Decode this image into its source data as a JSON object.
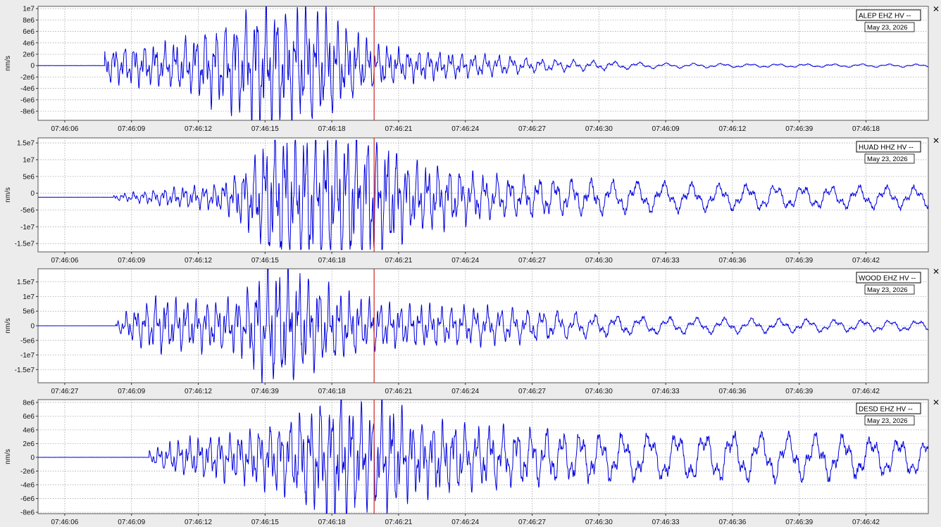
{
  "colors": {
    "trace": "#0000dd",
    "marker": "#cc2222",
    "grid": "#9a9a9a",
    "plot_bg": "#ffffff",
    "window_bg": "#ececec"
  },
  "icons": {
    "close": "close-icon"
  },
  "close_glyph": "✕",
  "chart_data": [
    {
      "type": "line",
      "station": "ALEP EHZ HV --",
      "date": "May 23, 2026",
      "ylabel": "nm/s",
      "yticks": [
        "1e7",
        "8e6",
        "6e6",
        "4e6",
        "2e6",
        "0",
        "-2e6",
        "-4e6",
        "-6e6",
        "-8e6"
      ],
      "xticks": [
        "07:46:06",
        "07:46:09",
        "07:46:12",
        "07:46:15",
        "07:46:18",
        "07:46:21",
        "07:46:24",
        "07:46:27",
        "07:46:30",
        "07:46:09",
        "07:46:12",
        "07:46:39",
        "07:46:18"
      ],
      "ylim": [
        -9600000,
        10400000
      ],
      "xlim": [
        4.8,
        44.8
      ],
      "marker_time": 19.9,
      "onset": 7.8,
      "envelope": [
        [
          7.8,
          2500000
        ],
        [
          9,
          3000000
        ],
        [
          11,
          3500000
        ],
        [
          12.5,
          5500000
        ],
        [
          14,
          8000000
        ],
        [
          15,
          9000000
        ],
        [
          17.5,
          8500000
        ],
        [
          19,
          5000000
        ],
        [
          20,
          3500000
        ],
        [
          21,
          2500000
        ],
        [
          23,
          2000000
        ],
        [
          25,
          1800000
        ],
        [
          27,
          1200000
        ],
        [
          30,
          900000
        ],
        [
          33,
          500000
        ],
        [
          36,
          400000
        ],
        [
          40,
          350000
        ],
        [
          44.8,
          300000
        ]
      ],
      "seed": 11,
      "clip": false
    },
    {
      "type": "line",
      "station": "HUAD HHZ HV --",
      "date": "May 23, 2026",
      "ylabel": "nm/s",
      "yticks": [
        "1.5e7",
        "1e7",
        "5e6",
        "0",
        "-5e6",
        "-1e7",
        "-1.5e7"
      ],
      "xticks": [
        "07:46:06",
        "07:46:09",
        "07:46:12",
        "07:46:15",
        "07:46:18",
        "07:46:21",
        "07:46:24",
        "07:46:27",
        "07:46:30",
        "07:46:33",
        "07:46:36",
        "07:46:39",
        "07:46:42"
      ],
      "ylim": [
        -17500000,
        16500000
      ],
      "xlim": [
        4.8,
        44.8
      ],
      "marker_time": 19.9,
      "onset": 8.2,
      "envelope": [
        [
          8.2,
          800000
        ],
        [
          9.5,
          1500000
        ],
        [
          11,
          2500000
        ],
        [
          13,
          3500000
        ],
        [
          14.3,
          9000000
        ],
        [
          15.3,
          17000000
        ],
        [
          18,
          17000000
        ],
        [
          19.6,
          17000000
        ],
        [
          20.6,
          14000000
        ],
        [
          21.5,
          9500000
        ],
        [
          23,
          8000000
        ],
        [
          25,
          6000000
        ],
        [
          30,
          5500000
        ],
        [
          35,
          4500000
        ],
        [
          40,
          4000000
        ],
        [
          44.8,
          3500000
        ]
      ],
      "seed": 23,
      "clip": true,
      "offset": -1200000
    },
    {
      "type": "line",
      "station": "WOOD EHZ HV --",
      "date": "May 23, 2026",
      "ylabel": "nm/s",
      "yticks": [
        "1.5e7",
        "1e7",
        "5e6",
        "0",
        "-5e6",
        "-1e7",
        "-1.5e7"
      ],
      "xticks": [
        "07:46:27",
        "07:46:09",
        "07:46:12",
        "07:46:39",
        "07:46:18",
        "07:46:21",
        "07:46:24",
        "07:46:27",
        "07:46:30",
        "07:46:33",
        "07:46:36",
        "07:46:39",
        "07:46:42"
      ],
      "ylim": [
        -19500000,
        19500000
      ],
      "xlim": [
        4.8,
        44.8
      ],
      "marker_time": 19.9,
      "onset": 8.3,
      "envelope": [
        [
          8.3,
          1500000
        ],
        [
          9,
          5000000
        ],
        [
          10,
          8000000
        ],
        [
          12.5,
          7000000
        ],
        [
          14,
          9000000
        ],
        [
          15,
          17000000
        ],
        [
          16,
          17000000
        ],
        [
          17.5,
          12000000
        ],
        [
          19,
          9000000
        ],
        [
          20.5,
          6500000
        ],
        [
          23,
          6000000
        ],
        [
          27,
          5500000
        ],
        [
          30,
          4000000
        ],
        [
          35,
          3000000
        ],
        [
          40,
          2500000
        ],
        [
          44.8,
          2000000
        ]
      ],
      "seed": 37,
      "clip": false
    },
    {
      "type": "line",
      "station": "DESD EHZ HV --",
      "date": "May 23, 2026",
      "ylabel": "nm/s",
      "yticks": [
        "8e6",
        "6e6",
        "4e6",
        "2e6",
        "0",
        "-2e6",
        "-4e6",
        "-6e6",
        "-8e6"
      ],
      "xticks": [
        "07:46:06",
        "07:46:09",
        "07:46:12",
        "07:46:15",
        "07:46:18",
        "07:46:21",
        "07:46:24",
        "07:46:27",
        "07:46:30",
        "07:46:33",
        "07:46:36",
        "07:46:39",
        "07:46:42"
      ],
      "ylim": [
        -8200000,
        8400000
      ],
      "xlim": [
        4.8,
        44.8
      ],
      "marker_time": 19.9,
      "onset": 9.8,
      "envelope": [
        [
          9.8,
          800000
        ],
        [
          11,
          2200000
        ],
        [
          14,
          3200000
        ],
        [
          16,
          4800000
        ],
        [
          17.2,
          6500000
        ],
        [
          18.3,
          8200000
        ],
        [
          19.5,
          6500000
        ],
        [
          20.6,
          7000000
        ],
        [
          21.5,
          5000000
        ],
        [
          25,
          4200000
        ],
        [
          30,
          3800000
        ],
        [
          35,
          4200000
        ],
        [
          40,
          3800000
        ],
        [
          44.8,
          3000000
        ]
      ],
      "seed": 53,
      "clip": false
    }
  ]
}
